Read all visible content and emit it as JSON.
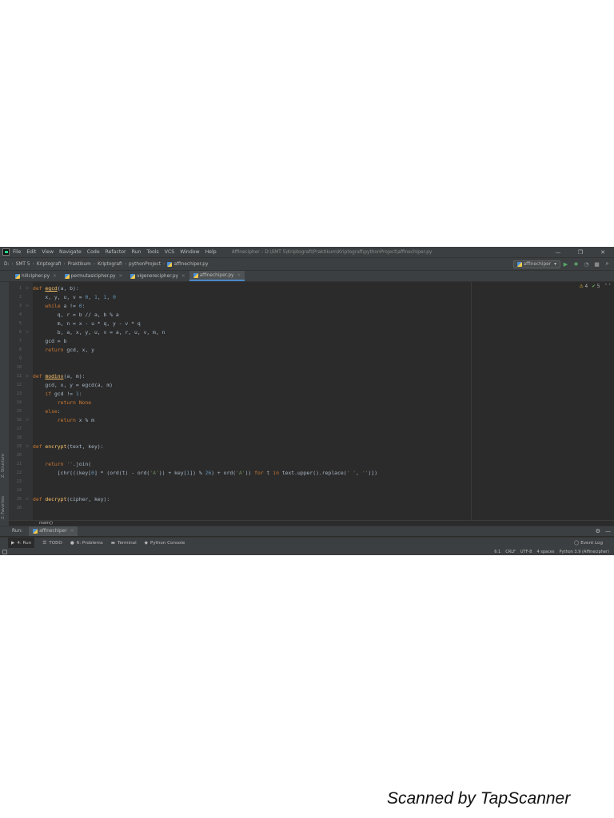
{
  "menubar": {
    "items": [
      "File",
      "Edit",
      "View",
      "Navigate",
      "Code",
      "Refactor",
      "Run",
      "Tools",
      "VCS",
      "Window",
      "Help"
    ],
    "title": "Affinecipher – D:\\SMT 5\\Kriptografi\\Praktikum\\Kriptografi\\pythonProject\\affinechiper.py",
    "controls": [
      "—",
      "❐",
      "✕"
    ]
  },
  "breadcrumb": {
    "items": [
      "D:",
      "SMT 5",
      "Kriptografi",
      "Praktikum",
      "Kriptografi",
      "pythonProject",
      "affinechiper.py"
    ],
    "run_config": "affinechiper"
  },
  "tabs": [
    {
      "label": "hillcipher.py",
      "active": false
    },
    {
      "label": "permutasicipher.py",
      "active": false
    },
    {
      "label": "vigenerecipher.py",
      "active": false
    },
    {
      "label": "affinechiper.py",
      "active": true
    }
  ],
  "editor": {
    "inspection_warnings": "4",
    "inspection_ok": "5",
    "footer_crumb": "main()",
    "lines": [
      {
        "n": "1",
        "tokens": [
          [
            "kw",
            "def "
          ],
          [
            "fn-ul",
            "egcd"
          ],
          [
            "",
            "(a, b):"
          ]
        ]
      },
      {
        "n": "2",
        "tokens": [
          [
            "",
            "    x, y, u, v = "
          ],
          [
            "num",
            "0"
          ],
          [
            "",
            ", "
          ],
          [
            "num",
            "1"
          ],
          [
            "",
            ", "
          ],
          [
            "num",
            "1"
          ],
          [
            "",
            ", "
          ],
          [
            "num",
            "0"
          ]
        ]
      },
      {
        "n": "3",
        "tokens": [
          [
            "kw",
            "    while "
          ],
          [
            "",
            "a != "
          ],
          [
            "num",
            "0"
          ],
          [
            "",
            ":"
          ]
        ]
      },
      {
        "n": "4",
        "tokens": [
          [
            "",
            "        q, r = b // a, b % a"
          ]
        ]
      },
      {
        "n": "5",
        "tokens": [
          [
            "",
            "        m, n = x - u * q, y - v * q"
          ]
        ]
      },
      {
        "n": "6",
        "tokens": [
          [
            "",
            "        b, a, x, y, u, v = a, r, u, v, m, n"
          ]
        ]
      },
      {
        "n": "7",
        "tokens": [
          [
            "",
            "    gcd = b"
          ]
        ]
      },
      {
        "n": "8",
        "tokens": [
          [
            "kw",
            "    return "
          ],
          [
            "",
            "gcd, x, y"
          ]
        ]
      },
      {
        "n": "9",
        "tokens": []
      },
      {
        "n": "10",
        "tokens": []
      },
      {
        "n": "11",
        "tokens": [
          [
            "kw",
            "def "
          ],
          [
            "fn-ul",
            "modinv"
          ],
          [
            "",
            "(a, m):"
          ]
        ]
      },
      {
        "n": "12",
        "tokens": [
          [
            "",
            "    gcd, x, y = egcd(a, m)"
          ]
        ]
      },
      {
        "n": "13",
        "tokens": [
          [
            "kw",
            "    if "
          ],
          [
            "",
            "gcd != "
          ],
          [
            "num",
            "1"
          ],
          [
            "",
            ":"
          ]
        ]
      },
      {
        "n": "14",
        "tokens": [
          [
            "kw",
            "        return None"
          ]
        ]
      },
      {
        "n": "15",
        "tokens": [
          [
            "kw",
            "    else"
          ],
          [
            "",
            ":"
          ]
        ]
      },
      {
        "n": "16",
        "tokens": [
          [
            "kw",
            "        return "
          ],
          [
            "",
            "x % m"
          ]
        ]
      },
      {
        "n": "17",
        "tokens": []
      },
      {
        "n": "18",
        "tokens": []
      },
      {
        "n": "19",
        "tokens": [
          [
            "kw",
            "def "
          ],
          [
            "fn",
            "encrypt"
          ],
          [
            "",
            "(text, key):"
          ]
        ]
      },
      {
        "n": "20",
        "tokens": []
      },
      {
        "n": "21",
        "tokens": [
          [
            "kw",
            "    return "
          ],
          [
            "str",
            "''"
          ],
          [
            "",
            ".join("
          ]
        ]
      },
      {
        "n": "22",
        "tokens": [
          [
            "",
            "        [chr(((key["
          ],
          [
            "num",
            "0"
          ],
          [
            "",
            "] * (ord(t) - ord("
          ],
          [
            "str",
            "'A'"
          ],
          [
            "",
            ")) + key["
          ],
          [
            "num",
            "1"
          ],
          [
            "",
            "]) % "
          ],
          [
            "num",
            "26"
          ],
          [
            "",
            ") + ord("
          ],
          [
            "str",
            "'A'"
          ],
          [
            "",
            "))"
          ],
          [
            "kw",
            " for "
          ],
          [
            "",
            "t"
          ],
          [
            "kw",
            " in "
          ],
          [
            "",
            "text.upper().replace("
          ],
          [
            "str",
            "' '"
          ],
          [
            "",
            ", "
          ],
          [
            "str",
            "''"
          ],
          [
            "",
            ")])"
          ]
        ]
      },
      {
        "n": "23",
        "tokens": []
      },
      {
        "n": "24",
        "tokens": []
      },
      {
        "n": "25",
        "tokens": [
          [
            "kw",
            "def "
          ],
          [
            "fn",
            "decrypt"
          ],
          [
            "",
            "(cipher, key):"
          ]
        ]
      },
      {
        "n": "26",
        "tokens": []
      }
    ]
  },
  "sidebar": {
    "structure": "Z: Structure",
    "favorites": "2: Favorites"
  },
  "run_panel": {
    "label": "Run:",
    "tab": "affinechiper"
  },
  "tool_windows": {
    "run": "4: Run",
    "todo": "TODO",
    "problems": "6: Problems",
    "terminal": "Terminal",
    "python_console": "Python Console",
    "event_log": "Event Log"
  },
  "status": {
    "position": "6:1",
    "line_sep": "CRLF",
    "encoding": "UTF-8",
    "indent": "4 spaces",
    "interpreter": "Python 3.9 (Affinecipher)"
  },
  "watermark": "Scanned by TapScanner"
}
